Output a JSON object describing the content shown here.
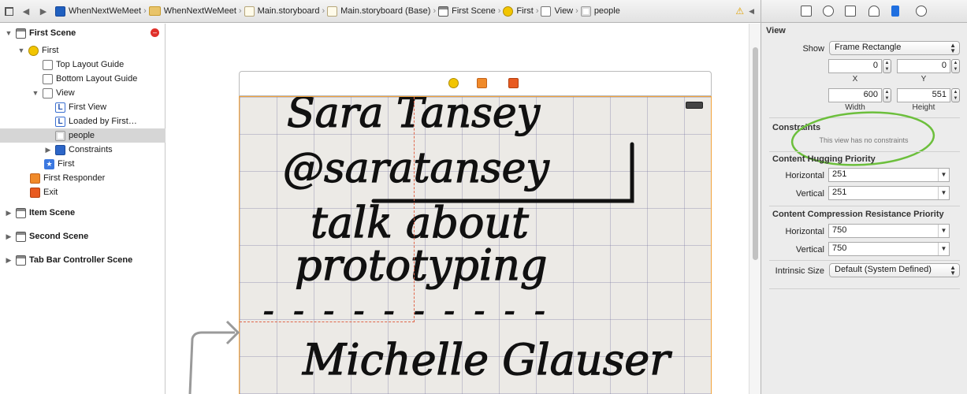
{
  "jumpbar": {
    "crumbs": [
      "WhenNextWeMeet",
      "WhenNextWeMeet",
      "Main.storyboard",
      "Main.storyboard (Base)",
      "First Scene",
      "First",
      "View",
      "people"
    ]
  },
  "navigator": {
    "items": [
      {
        "label": "First Scene",
        "bold": true
      },
      {
        "label": "First"
      },
      {
        "label": "Top Layout Guide"
      },
      {
        "label": "Bottom Layout Guide"
      },
      {
        "label": "View"
      },
      {
        "label": "First View"
      },
      {
        "label": "Loaded by First…"
      },
      {
        "label": "people"
      },
      {
        "label": "Constraints"
      },
      {
        "label": "First"
      },
      {
        "label": "First Responder"
      },
      {
        "label": "Exit"
      },
      {
        "label": "Item Scene",
        "bold": true
      },
      {
        "label": "Second Scene",
        "bold": true
      },
      {
        "label": "Tab Bar Controller Scene",
        "bold": true
      }
    ]
  },
  "inspector": {
    "view_section": "View",
    "show_label": "Show",
    "show_value": "Frame Rectangle",
    "x_value": "0",
    "y_value": "0",
    "x_label": "X",
    "y_label": "Y",
    "width_value": "600",
    "height_value": "551",
    "width_label": "Width",
    "height_label": "Height",
    "constraints_title": "Constraints",
    "constraints_note": "This view has no constraints",
    "hugging_title": "Content Hugging Priority",
    "hugging_h_label": "Horizontal",
    "hugging_h_value": "251",
    "hugging_v_label": "Vertical",
    "hugging_v_value": "251",
    "compression_title": "Content Compression Resistance Priority",
    "compression_h_label": "Horizontal",
    "compression_h_value": "750",
    "compression_v_label": "Vertical",
    "compression_v_value": "750",
    "intrinsic_label": "Intrinsic Size",
    "intrinsic_value": "Default (System Defined)"
  },
  "canvas": {
    "handwriting": [
      "Sara Tansey",
      "@saratansey",
      "talk about",
      "prototyping",
      "- - - - - - - - - -",
      "Michelle Glauser"
    ]
  },
  "colors": {
    "selection_border": "#f3a33a",
    "annotation_circle": "#6cbf3c",
    "selected_row": "#d6d6d6"
  }
}
